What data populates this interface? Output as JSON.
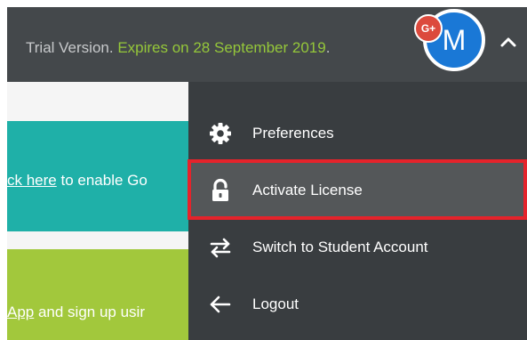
{
  "header": {
    "trial_prefix": "Trial Version.",
    "trial_expires": "Expires on 28 September 2019",
    "trial_suffix": ".",
    "avatar_letter": "M",
    "badge": "G+"
  },
  "banners": {
    "teal": {
      "link": "ck here",
      "text": " to enable Go"
    },
    "green": {
      "link": "App",
      "text": " and sign up usir"
    }
  },
  "menu": {
    "items": [
      {
        "label": "Preferences",
        "icon": "gear-icon"
      },
      {
        "label": "Activate License",
        "icon": "unlock-icon"
      },
      {
        "label": "Switch to Student Account",
        "icon": "switch-arrows-icon"
      },
      {
        "label": "Logout",
        "icon": "arrow-left-icon"
      }
    ]
  },
  "colors": {
    "topbar": "#44484b",
    "menu_bg": "#393d40",
    "menu_highlight": "#545759",
    "accent_green": "#95c73a",
    "teal": "#1fb0a8",
    "lime": "#a2c83c",
    "avatar_blue": "#1a78d6",
    "google_red": "#dc4a3d",
    "callout_red": "#e5232b"
  }
}
